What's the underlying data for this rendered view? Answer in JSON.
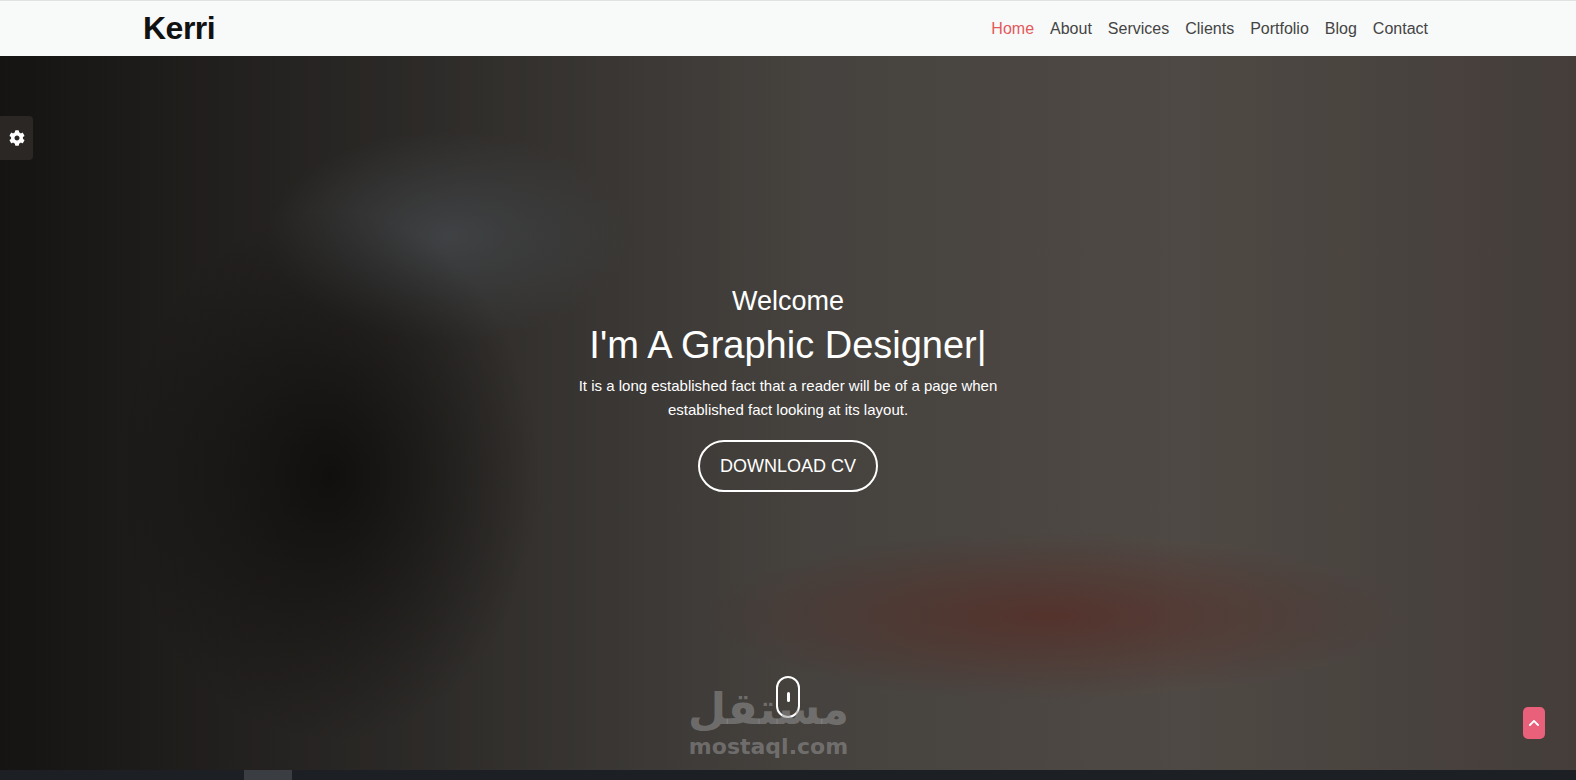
{
  "logo": "Kerri",
  "nav": [
    {
      "label": "Home",
      "selected": true
    },
    {
      "label": "About",
      "selected": false
    },
    {
      "label": "Services",
      "selected": false
    },
    {
      "label": "Clients",
      "selected": false
    },
    {
      "label": "Portfolio",
      "selected": false
    },
    {
      "label": "Blog",
      "selected": false
    },
    {
      "label": "Contact",
      "selected": false
    }
  ],
  "hero": {
    "greeting": "Welcome",
    "title": "I'm A Graphic Designer|",
    "text": "It is a long established fact that a reader will be of a page when established fact looking at its layout.",
    "button": "DOWNLOAD CV"
  },
  "watermark": {
    "arabic": "مستقل",
    "latin": "mostaql.com"
  }
}
